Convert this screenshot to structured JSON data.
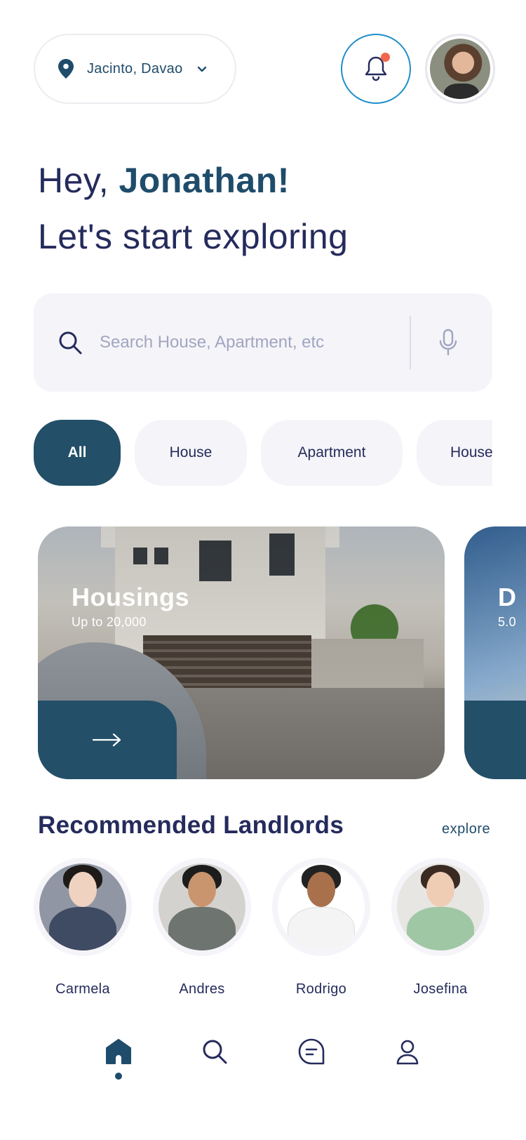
{
  "header": {
    "location": "Jacinto, Davao",
    "notification_has_badge": true,
    "accent_color": "#1f8fc7",
    "badge_color": "#f2664b"
  },
  "greeting": {
    "hey": "Hey, ",
    "name": "Jonathan!",
    "subtitle": "Let's start exploring"
  },
  "search": {
    "placeholder": "Search House, Apartment, etc",
    "value": ""
  },
  "categories": [
    {
      "label": "All",
      "active": true
    },
    {
      "label": "House",
      "active": false
    },
    {
      "label": "Apartment",
      "active": false
    },
    {
      "label": "House",
      "active": false
    }
  ],
  "featured_cards": [
    {
      "title": "Housings",
      "price": "Up to  20,000"
    },
    {
      "title": "D",
      "price": "5.0"
    }
  ],
  "landlords_section": {
    "title": "Recommended Landlords",
    "explore_label": "explore",
    "landlords": [
      {
        "name": "Carmela"
      },
      {
        "name": "Andres"
      },
      {
        "name": "Rodrigo"
      },
      {
        "name": "Josefina"
      }
    ]
  },
  "bottom_nav": {
    "items": [
      {
        "icon": "home-icon",
        "active": true
      },
      {
        "icon": "search-icon",
        "active": false
      },
      {
        "icon": "chat-icon",
        "active": false
      },
      {
        "icon": "profile-icon",
        "active": false
      }
    ]
  },
  "colors": {
    "primary": "#234f68",
    "text": "#252b5c",
    "surface": "#f5f4f8"
  }
}
